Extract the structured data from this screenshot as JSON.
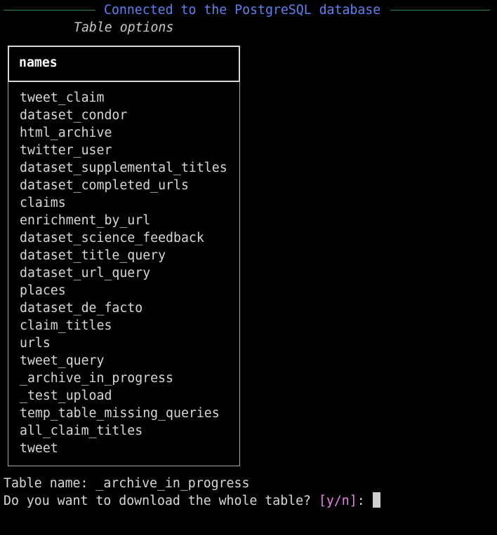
{
  "header": {
    "title": "Connected to the PostgreSQL database",
    "subtitle": "Table options"
  },
  "table": {
    "column_header": "names",
    "rows": [
      "tweet_claim",
      "dataset_condor",
      "html_archive",
      "twitter_user",
      "dataset_supplemental_titles",
      "dataset_completed_urls",
      "claims",
      "enrichment_by_url",
      "dataset_science_feedback",
      "dataset_title_query",
      "dataset_url_query",
      "places",
      "dataset_de_facto",
      "claim_titles",
      "urls",
      "tweet_query",
      "_archive_in_progress",
      "_test_upload",
      "temp_table_missing_queries",
      "all_claim_titles",
      "tweet"
    ]
  },
  "prompt": {
    "table_name_line": "Table name: _archive_in_progress",
    "question": "Do you want to download the whole table? ",
    "options": "[y/n]",
    "suffix": ": "
  },
  "colors": {
    "title": "#5b82f2",
    "rule": "#2e8b3e",
    "options": "#f07ef0"
  }
}
